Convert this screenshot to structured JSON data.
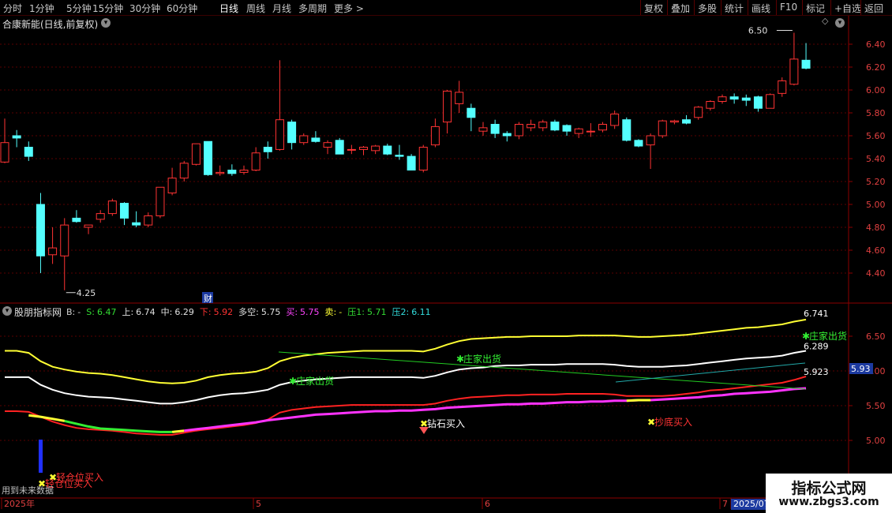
{
  "toolbar": {
    "periods": [
      "分时",
      "1分钟",
      "5分钟",
      "15分钟",
      "30分钟",
      "60分钟",
      "日线",
      "周线",
      "月线",
      "多周期",
      "更多 >"
    ],
    "active_period": "日线",
    "right_buttons": [
      "复权",
      "叠加",
      "多股",
      "统计",
      "画线",
      "F10",
      "标记",
      "+自选",
      "返回"
    ]
  },
  "main_chart": {
    "title": "合康新能(日线,前复权)",
    "high_label": "6.50",
    "low_label": "4.25",
    "fin_marker": "财",
    "y_ticks": [
      "6.40",
      "6.20",
      "6.00",
      "5.80",
      "5.60",
      "5.40",
      "5.20",
      "5.00",
      "4.80",
      "4.60",
      "4.40"
    ]
  },
  "indicator": {
    "name": "股朋指标网",
    "legend": [
      {
        "label": "B:",
        "value": "-",
        "color": "#d0d0d0"
      },
      {
        "label": "S:",
        "value": "6.47",
        "color": "#33dd33"
      },
      {
        "label": "上:",
        "value": "6.74",
        "color": "#e0e0e0"
      },
      {
        "label": "中:",
        "value": "6.29",
        "color": "#e0e0e0"
      },
      {
        "label": "下:",
        "value": "5.92",
        "color": "#ff3333"
      },
      {
        "label": "多空:",
        "value": "5.75",
        "color": "#e0e0e0"
      },
      {
        "label": "买:",
        "value": "5.75",
        "color": "#ff44ff"
      },
      {
        "label": "卖:",
        "value": "-",
        "color": "#ffff33"
      },
      {
        "label": "压1:",
        "value": "5.71",
        "color": "#33dd33"
      },
      {
        "label": "压2:",
        "value": "6.11",
        "color": "#33dddd"
      }
    ],
    "y_ticks": [
      "6.50",
      "6.00",
      "5.50",
      "5.00"
    ],
    "current_value": "5.93",
    "line_end_labels": [
      "6.741",
      "6.289",
      "5.923"
    ],
    "signals": [
      "庄家出货",
      "庄家出货",
      "庄家出货",
      "钻石买入",
      "抄底买入",
      "轻仓位买入",
      "轻仓位买入"
    ],
    "future_data_note": "用到未来数据"
  },
  "time_axis": {
    "labels": [
      "2025年",
      "5",
      "6",
      "7",
      "2025/07"
    ]
  },
  "watermark": {
    "title": "指标公式网",
    "url": "www.zbgs3.com"
  },
  "colors": {
    "up": "#ff3333",
    "down": "#54ffff",
    "grid": "#5a0000",
    "upper": "#ffff33",
    "middle": "#ffffff",
    "lower": "#ff2222",
    "buy": "#ff33ff",
    "green": "#33ee33"
  },
  "chart_data": {
    "type": "candlestick",
    "title": "合康新能(日线,前复权)",
    "ylim": [
      4.28,
      6.54
    ],
    "candles": [
      {
        "o": 5.37,
        "h": 5.75,
        "l": 5.36,
        "c": 5.54
      },
      {
        "o": 5.6,
        "h": 5.65,
        "l": 5.5,
        "c": 5.58
      },
      {
        "o": 5.5,
        "h": 5.55,
        "l": 5.38,
        "c": 5.42
      },
      {
        "o": 5.0,
        "h": 5.1,
        "l": 4.4,
        "c": 4.55
      },
      {
        "o": 4.56,
        "h": 4.8,
        "l": 4.48,
        "c": 4.62
      },
      {
        "o": 4.55,
        "h": 4.88,
        "l": 4.25,
        "c": 4.82
      },
      {
        "o": 4.88,
        "h": 4.95,
        "l": 4.84,
        "c": 4.85
      },
      {
        "o": 4.8,
        "h": 4.82,
        "l": 4.74,
        "c": 4.82
      },
      {
        "o": 4.87,
        "h": 4.95,
        "l": 4.84,
        "c": 4.92
      },
      {
        "o": 4.92,
        "h": 5.05,
        "l": 4.9,
        "c": 5.03
      },
      {
        "o": 5.01,
        "h": 5.02,
        "l": 4.82,
        "c": 4.88
      },
      {
        "o": 4.84,
        "h": 4.94,
        "l": 4.8,
        "c": 4.82
      },
      {
        "o": 4.82,
        "h": 4.93,
        "l": 4.8,
        "c": 4.9
      },
      {
        "o": 4.9,
        "h": 5.15,
        "l": 4.88,
        "c": 5.15
      },
      {
        "o": 5.1,
        "h": 5.32,
        "l": 5.08,
        "c": 5.23
      },
      {
        "o": 5.23,
        "h": 5.38,
        "l": 5.2,
        "c": 5.36
      },
      {
        "o": 5.35,
        "h": 5.53,
        "l": 5.34,
        "c": 5.53
      },
      {
        "o": 5.55,
        "h": 5.55,
        "l": 5.25,
        "c": 5.26
      },
      {
        "o": 5.27,
        "h": 5.34,
        "l": 5.25,
        "c": 5.28
      },
      {
        "o": 5.3,
        "h": 5.35,
        "l": 5.25,
        "c": 5.27
      },
      {
        "o": 5.28,
        "h": 5.34,
        "l": 5.26,
        "c": 5.3
      },
      {
        "o": 5.3,
        "h": 5.5,
        "l": 5.29,
        "c": 5.45
      },
      {
        "o": 5.5,
        "h": 5.55,
        "l": 5.4,
        "c": 5.46
      },
      {
        "o": 5.48,
        "h": 6.26,
        "l": 5.47,
        "c": 5.74
      },
      {
        "o": 5.72,
        "h": 5.74,
        "l": 5.48,
        "c": 5.54
      },
      {
        "o": 5.54,
        "h": 5.62,
        "l": 5.52,
        "c": 5.6
      },
      {
        "o": 5.58,
        "h": 5.64,
        "l": 5.54,
        "c": 5.55
      },
      {
        "o": 5.5,
        "h": 5.56,
        "l": 5.44,
        "c": 5.54
      },
      {
        "o": 5.56,
        "h": 5.58,
        "l": 5.44,
        "c": 5.44
      },
      {
        "o": 5.48,
        "h": 5.52,
        "l": 5.44,
        "c": 5.48
      },
      {
        "o": 5.48,
        "h": 5.51,
        "l": 5.43,
        "c": 5.5
      },
      {
        "o": 5.47,
        "h": 5.52,
        "l": 5.44,
        "c": 5.51
      },
      {
        "o": 5.51,
        "h": 5.53,
        "l": 5.43,
        "c": 5.44
      },
      {
        "o": 5.43,
        "h": 5.52,
        "l": 5.39,
        "c": 5.42
      },
      {
        "o": 5.42,
        "h": 5.44,
        "l": 5.3,
        "c": 5.3
      },
      {
        "o": 5.3,
        "h": 5.52,
        "l": 5.28,
        "c": 5.5
      },
      {
        "o": 5.52,
        "h": 5.75,
        "l": 5.5,
        "c": 5.68
      },
      {
        "o": 5.72,
        "h": 6.0,
        "l": 5.62,
        "c": 5.99
      },
      {
        "o": 5.88,
        "h": 6.08,
        "l": 5.8,
        "c": 5.98
      },
      {
        "o": 5.84,
        "h": 5.88,
        "l": 5.64,
        "c": 5.76
      },
      {
        "o": 5.64,
        "h": 5.72,
        "l": 5.6,
        "c": 5.67
      },
      {
        "o": 5.7,
        "h": 5.74,
        "l": 5.58,
        "c": 5.62
      },
      {
        "o": 5.62,
        "h": 5.64,
        "l": 5.55,
        "c": 5.6
      },
      {
        "o": 5.6,
        "h": 5.72,
        "l": 5.57,
        "c": 5.7
      },
      {
        "o": 5.67,
        "h": 5.74,
        "l": 5.64,
        "c": 5.7
      },
      {
        "o": 5.67,
        "h": 5.74,
        "l": 5.64,
        "c": 5.72
      },
      {
        "o": 5.72,
        "h": 5.74,
        "l": 5.64,
        "c": 5.65
      },
      {
        "o": 5.69,
        "h": 5.7,
        "l": 5.6,
        "c": 5.64
      },
      {
        "o": 5.62,
        "h": 5.67,
        "l": 5.58,
        "c": 5.66
      },
      {
        "o": 5.64,
        "h": 5.71,
        "l": 5.59,
        "c": 5.64
      },
      {
        "o": 5.65,
        "h": 5.72,
        "l": 5.63,
        "c": 5.7
      },
      {
        "o": 5.69,
        "h": 5.82,
        "l": 5.66,
        "c": 5.79
      },
      {
        "o": 5.74,
        "h": 5.76,
        "l": 5.55,
        "c": 5.56
      },
      {
        "o": 5.56,
        "h": 5.57,
        "l": 5.5,
        "c": 5.51
      },
      {
        "o": 5.52,
        "h": 5.62,
        "l": 5.31,
        "c": 5.6
      },
      {
        "o": 5.6,
        "h": 5.74,
        "l": 5.58,
        "c": 5.73
      },
      {
        "o": 5.72,
        "h": 5.74,
        "l": 5.7,
        "c": 5.73
      },
      {
        "o": 5.74,
        "h": 5.78,
        "l": 5.7,
        "c": 5.71
      },
      {
        "o": 5.76,
        "h": 5.86,
        "l": 5.74,
        "c": 5.85
      },
      {
        "o": 5.84,
        "h": 5.91,
        "l": 5.82,
        "c": 5.9
      },
      {
        "o": 5.9,
        "h": 5.96,
        "l": 5.88,
        "c": 5.94
      },
      {
        "o": 5.94,
        "h": 5.97,
        "l": 5.88,
        "c": 5.92
      },
      {
        "o": 5.93,
        "h": 5.96,
        "l": 5.86,
        "c": 5.91
      },
      {
        "o": 5.94,
        "h": 5.95,
        "l": 5.81,
        "c": 5.84
      },
      {
        "o": 5.84,
        "h": 5.97,
        "l": 5.84,
        "c": 5.96
      },
      {
        "o": 5.97,
        "h": 6.11,
        "l": 5.94,
        "c": 6.08
      },
      {
        "o": 6.05,
        "h": 6.5,
        "l": 6.04,
        "c": 6.27
      },
      {
        "o": 6.26,
        "h": 6.41,
        "l": 6.18,
        "c": 6.19
      }
    ]
  }
}
